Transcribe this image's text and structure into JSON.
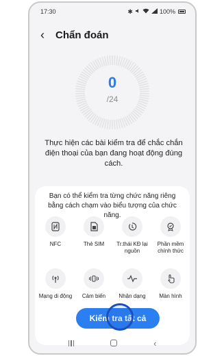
{
  "status": {
    "time": "17:30",
    "battery": "100%"
  },
  "header": {
    "title": "Chẩn đoán"
  },
  "progress": {
    "count": "0",
    "total": "/24",
    "completed": 0,
    "total_tests": 24
  },
  "intro": "Thực hiện các bài kiểm tra để chắc chắn điện thoại của bạn đang hoạt động đúng cách.",
  "panel": {
    "description": "Bạn có thể kiểm tra từng chức năng riêng bằng cách chạm vào biểu tượng của chức năng.",
    "tests": [
      {
        "label": "NFC",
        "icon": "nfc-icon"
      },
      {
        "label": "Thẻ SIM",
        "icon": "sim-card-icon"
      },
      {
        "label": "Tr.thái KĐ lại nguồn",
        "icon": "power-restart-icon"
      },
      {
        "label": "Phần mềm chính thức",
        "icon": "official-software-badge-icon"
      },
      {
        "label": "Mạng di động",
        "icon": "cellular-signal-icon"
      },
      {
        "label": "Cảm biến",
        "icon": "sensor-icon"
      },
      {
        "label": "Nhận dạng",
        "icon": "waveform-icon"
      },
      {
        "label": "Màn hình",
        "icon": "touch-screen-icon"
      }
    ],
    "run_all_label": "Kiểm tra tất cả"
  },
  "colors": {
    "accent": "#2c7ff0",
    "gauge_number": "#2b7de9",
    "touch_ring": "#1a4fbf"
  }
}
